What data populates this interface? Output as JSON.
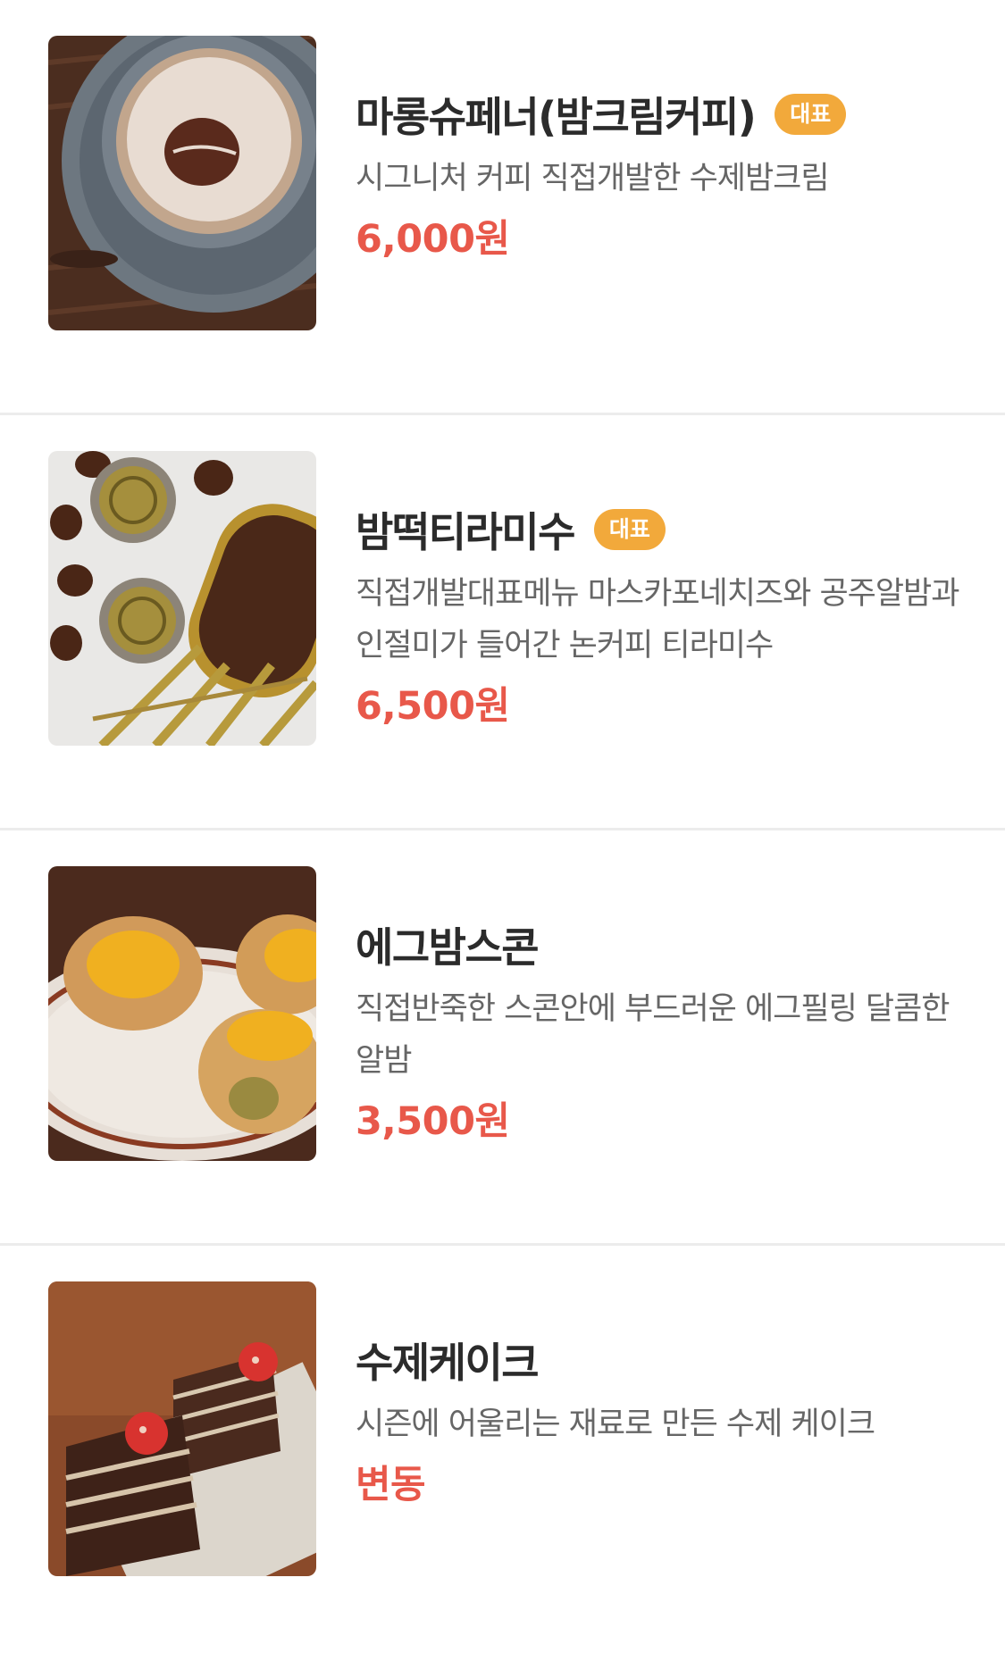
{
  "menu": {
    "items": [
      {
        "title": "마롱슈페너(밤크림커피)",
        "badge": "대표",
        "description": "시그니처 커피 직접개발한 수제밤크림",
        "price": "6,000원",
        "image_icon": "coffee-cup-photo"
      },
      {
        "title": "밤떡티라미수",
        "badge": "대표",
        "description": "직접개발대표메뉴 마스카포네치즈와 공주알밤과 인절미가 들어간 논커피 티라미수",
        "price": "6,500원",
        "image_icon": "tiramisu-photo"
      },
      {
        "title": "에그밤스콘",
        "description": "직접반죽한 스콘안에 부드러운 에그필링 달콤한 알밤",
        "price": "3,500원",
        "image_icon": "scone-photo"
      },
      {
        "title": "수제케이크",
        "description": "시즌에 어울리는 재료로 만든 수제 케이크",
        "price": "변동",
        "image_icon": "cake-photo"
      }
    ]
  },
  "colors": {
    "badge": "#f2a93b",
    "price": "#e8584a",
    "title": "#2b2b2b",
    "description": "#666666",
    "divider": "#ececec"
  }
}
